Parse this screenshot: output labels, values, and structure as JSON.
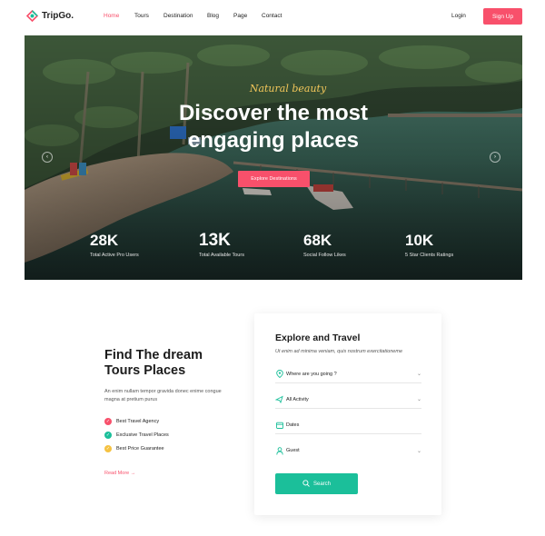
{
  "brand": {
    "name": "TripGo.",
    "accent": "#f8506b",
    "teal": "#1bbf9a"
  },
  "nav": {
    "items": [
      {
        "label": "Home",
        "active": true
      },
      {
        "label": "Tours",
        "active": false
      },
      {
        "label": "Destination",
        "active": false
      },
      {
        "label": "Blog",
        "active": false
      },
      {
        "label": "Page",
        "active": false
      },
      {
        "label": "Contact",
        "active": false
      }
    ],
    "login": "Login",
    "signup": "Sign Up"
  },
  "hero": {
    "script": "Natural beauty",
    "title": "Discover the most engaging places",
    "button": "Explore Destinations",
    "stats": [
      {
        "value": "28K",
        "label": "Total Active Pro Users"
      },
      {
        "value": "13K",
        "label": "Total Available Tours"
      },
      {
        "value": "68K",
        "label": "Social Follow Likes"
      },
      {
        "value": "10K",
        "label": "5 Star Clients Ratings"
      }
    ]
  },
  "find": {
    "title": "Find The dream Tours Places",
    "description": "An enim nullam tempor gravida donec enime congue magna at pretium purus",
    "features": [
      {
        "label": "Best Travel Agency",
        "color": "#f8506b"
      },
      {
        "label": "Exclusive Travel Places",
        "color": "#1bbf9a"
      },
      {
        "label": "Best Price Guarantee",
        "color": "#f5c242"
      }
    ],
    "read_more": "Read More →"
  },
  "explore": {
    "title": "Explore and Travel",
    "subtitle": "Ut enim ad minima veniam, quis nostrum exercitationeme",
    "fields": [
      {
        "label": "Where are you going ?",
        "icon": "location-pin-icon",
        "dropdown": true
      },
      {
        "label": "All Activity",
        "icon": "plane-icon",
        "dropdown": true
      },
      {
        "label": "Dates",
        "icon": "calendar-icon",
        "dropdown": false
      },
      {
        "label": "Guest",
        "icon": "user-icon",
        "dropdown": true
      }
    ],
    "search": "Search"
  }
}
